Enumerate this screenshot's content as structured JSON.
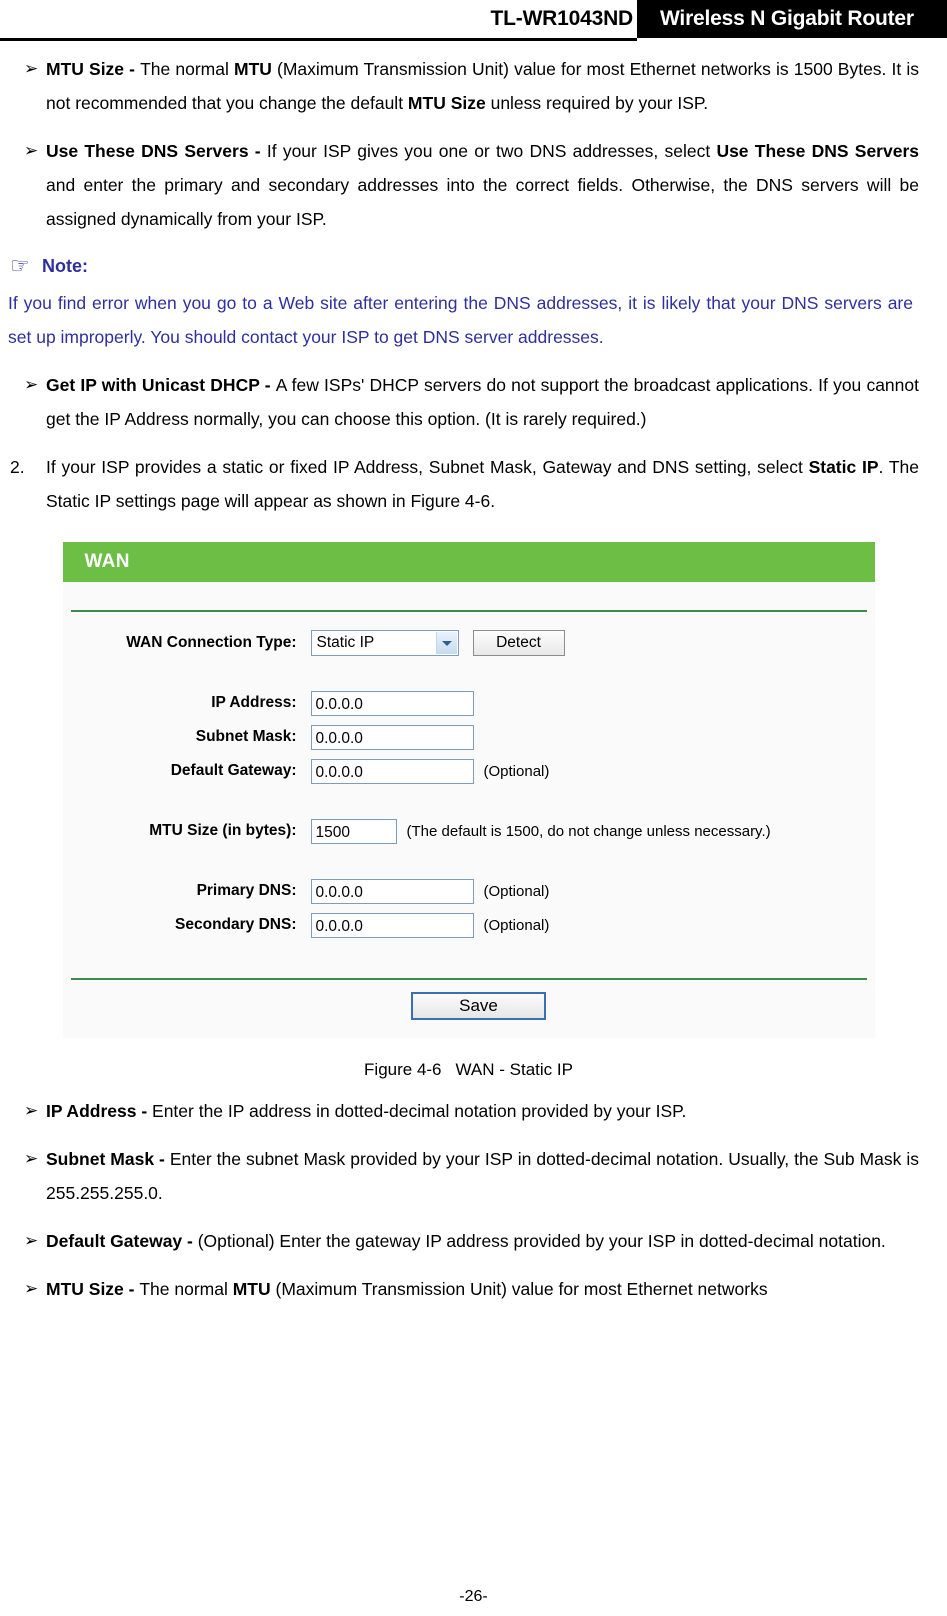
{
  "header": {
    "model": "TL-WR1043ND",
    "product": "Wireless N Gigabit Router"
  },
  "bullets_top": [
    {
      "marker": "➢",
      "term": "MTU Size - ",
      "text_1": "The normal ",
      "term_2": "MTU",
      "text_2": " (Maximum Transmission Unit) value for most Ethernet networks is 1500 Bytes. It is not recommended that you change the default ",
      "term_3": "MTU Size",
      "text_3": " unless required by your ISP."
    },
    {
      "marker": "➢",
      "term": "Use These DNS Servers - ",
      "text_1": "If your ISP gives you one or two DNS addresses, select ",
      "term_2": "Use These DNS Servers",
      "text_2": " and enter the primary and secondary addresses into the correct fields. Otherwise, the DNS servers will be assigned dynamically from your ISP.",
      "term_3": "",
      "text_3": ""
    }
  ],
  "note": {
    "hand_icon": "☞",
    "title": "Note:",
    "body": "If you find error when you go to a Web site after entering the DNS addresses, it is likely that your DNS servers are set up improperly. You should contact your ISP to get DNS server addresses.",
    "color": "#2f2f9e"
  },
  "bullet_dhcp": {
    "marker": "➢",
    "term": "Get IP with Unicast DHCP - ",
    "text": "A few ISPs' DHCP servers do not support the broadcast applications. If you cannot get the IP Address normally, you can choose this option. (It is rarely required.)"
  },
  "numbered_item": {
    "marker": "2.",
    "text_1": "If your ISP provides a static or fixed IP Address, Subnet Mask, Gateway and DNS setting, select ",
    "term": "Static IP",
    "text_2": ". The Static IP settings page will appear as shown in Figure 4-6."
  },
  "wan_panel": {
    "title": "WAN",
    "title_bg": "#6cbe45",
    "divider_color": "#3c8a4e",
    "connection_type": {
      "label": "WAN Connection Type:",
      "value": "Static IP",
      "detect_label": "Detect"
    },
    "fields": [
      {
        "label": "IP Address:",
        "value": "0.0.0.0",
        "hint": ""
      },
      {
        "label": "Subnet Mask:",
        "value": "0.0.0.0",
        "hint": ""
      },
      {
        "label": "Default Gateway:",
        "value": "0.0.0.0",
        "hint": "(Optional)"
      }
    ],
    "mtu": {
      "label": "MTU Size (in bytes):",
      "value": "1500",
      "hint": "(The default is 1500, do not change unless necessary.)"
    },
    "dns": [
      {
        "label": "Primary DNS:",
        "value": "0.0.0.0",
        "hint": "(Optional)"
      },
      {
        "label": "Secondary DNS:",
        "value": "0.0.0.0",
        "hint": "(Optional)"
      }
    ],
    "save_label": "Save"
  },
  "figure_caption": {
    "number": "Figure 4-6",
    "title": "WAN - Static IP"
  },
  "bullets_bottom": [
    {
      "marker": "➢",
      "term": "IP Address - ",
      "text": "Enter the IP address in dotted-decimal notation provided by your ISP."
    },
    {
      "marker": "➢",
      "term": "Subnet Mask - ",
      "text": "Enter the subnet Mask provided by your ISP in dotted-decimal notation. Usually, the Sub Mask is 255.255.255.0."
    },
    {
      "marker": "➢",
      "term": "Default Gateway - ",
      "text": "(Optional) Enter the gateway IP address provided by your ISP in dotted-decimal notation."
    }
  ],
  "bullet_last": {
    "marker": "➢",
    "term": "MTU Size - ",
    "text_1": "The normal ",
    "term_2": "MTU",
    "text_2": " (Maximum Transmission Unit) value for most Ethernet networks"
  },
  "footer": {
    "page_number": "-26-"
  }
}
